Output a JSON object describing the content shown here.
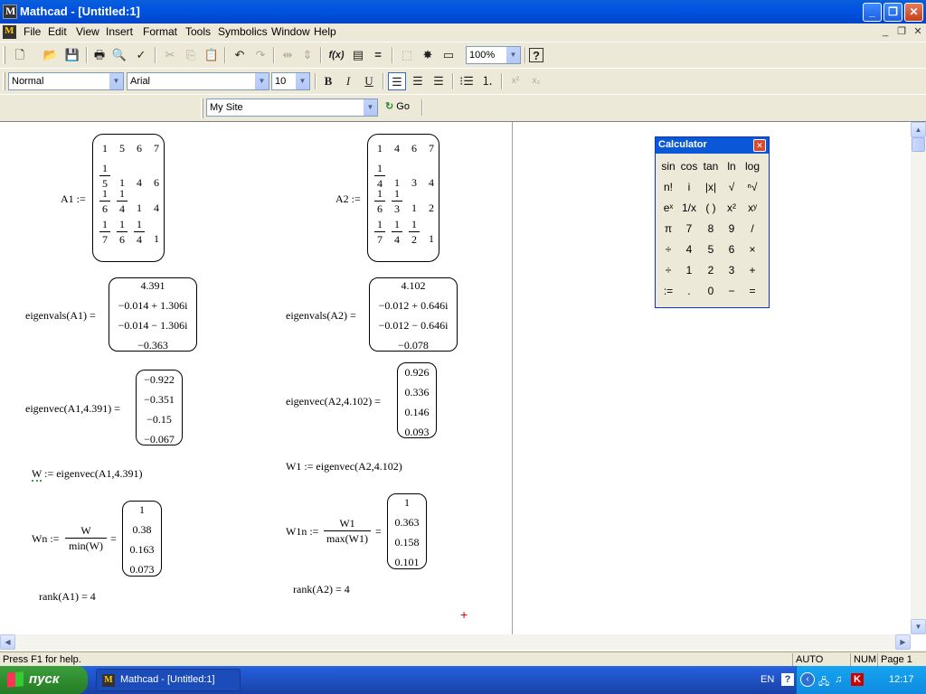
{
  "window": {
    "title": "Mathcad - [Untitled:1]"
  },
  "menu": [
    "File",
    "Edit",
    "View",
    "Insert",
    "Format",
    "Tools",
    "Symbolics",
    "Window",
    "Help"
  ],
  "toolbar": {
    "zoom": "100%",
    "style": "Normal",
    "font": "Arial",
    "size": "10",
    "url": "My Site",
    "go": "Go"
  },
  "sheet": {
    "a1_label": "A1 :=",
    "a2_label": "A2 :=",
    "a1_rows": [
      [
        "1",
        "5",
        "6",
        "7"
      ],
      [
        "1/5",
        "1",
        "4",
        "6"
      ],
      [
        "1/6",
        "1/4",
        "1",
        "4"
      ],
      [
        "1/7",
        "1/6",
        "1/4",
        "1"
      ]
    ],
    "a2_rows": [
      [
        "1",
        "4",
        "6",
        "7"
      ],
      [
        "1/4",
        "1",
        "3",
        "4"
      ],
      [
        "1/6",
        "1/3",
        "1",
        "2"
      ],
      [
        "1/7",
        "1/4",
        "1/2",
        "1"
      ]
    ],
    "eig1_label": "eigenvals(A1) =",
    "eig1_vals": [
      "4.391",
      "−0.014 + 1.306i",
      "−0.014 − 1.306i",
      "−0.363"
    ],
    "eig2_label": "eigenvals(A2) =",
    "eig2_vals": [
      "4.102",
      "−0.012 + 0.646i",
      "−0.012 − 0.646i",
      "−0.078"
    ],
    "vec1_label": "eigenvec(A1,4.391) =",
    "vec1_vals": [
      "−0.922",
      "−0.351",
      "−0.15",
      "−0.067"
    ],
    "vec2_label": "eigenvec(A2,4.102) =",
    "vec2_vals": [
      "0.926",
      "0.336",
      "0.146",
      "0.093"
    ],
    "w_w": "W",
    "w_rest": " := eigenvec(A1,4.391)",
    "w1_def": "W1 := eigenvec(A2,4.102)",
    "wn_lhs": "Wn :=",
    "wn_num": "W",
    "wn_den": "min(W)",
    "wn_vals": [
      "1",
      "0.38",
      "0.163",
      "0.073"
    ],
    "w1n_lhs": "W1n :=",
    "w1n_num": "W1",
    "w1n_den": "max(W1)",
    "w1n_vals": [
      "1",
      "0.363",
      "0.158",
      "0.101"
    ],
    "eq": "=",
    "rank1": "rank(A1) = 4",
    "rank2": "rank(A2) = 4"
  },
  "calculator": {
    "title": "Calculator",
    "keys": [
      [
        "sin",
        "cos",
        "tan",
        "ln",
        "log"
      ],
      [
        "n!",
        "i",
        "|x|",
        "√",
        "ⁿ√"
      ],
      [
        "eˣ",
        "1/x",
        "( )",
        "x²",
        "xʸ"
      ],
      [
        "π",
        "7",
        "8",
        "9",
        "/"
      ],
      [
        "÷",
        "4",
        "5",
        "6",
        "×"
      ],
      [
        "÷",
        "1",
        "2",
        "3",
        "+"
      ],
      [
        ":=",
        ".",
        "0",
        "−",
        "="
      ]
    ]
  },
  "status": {
    "help": "Press F1 for help.",
    "auto": "AUTO",
    "num": "NUM",
    "page": "Page 1"
  },
  "taskbar": {
    "start": "пуск",
    "task": "Mathcad - [Untitled:1]",
    "lang": "EN",
    "time": "12:17"
  }
}
